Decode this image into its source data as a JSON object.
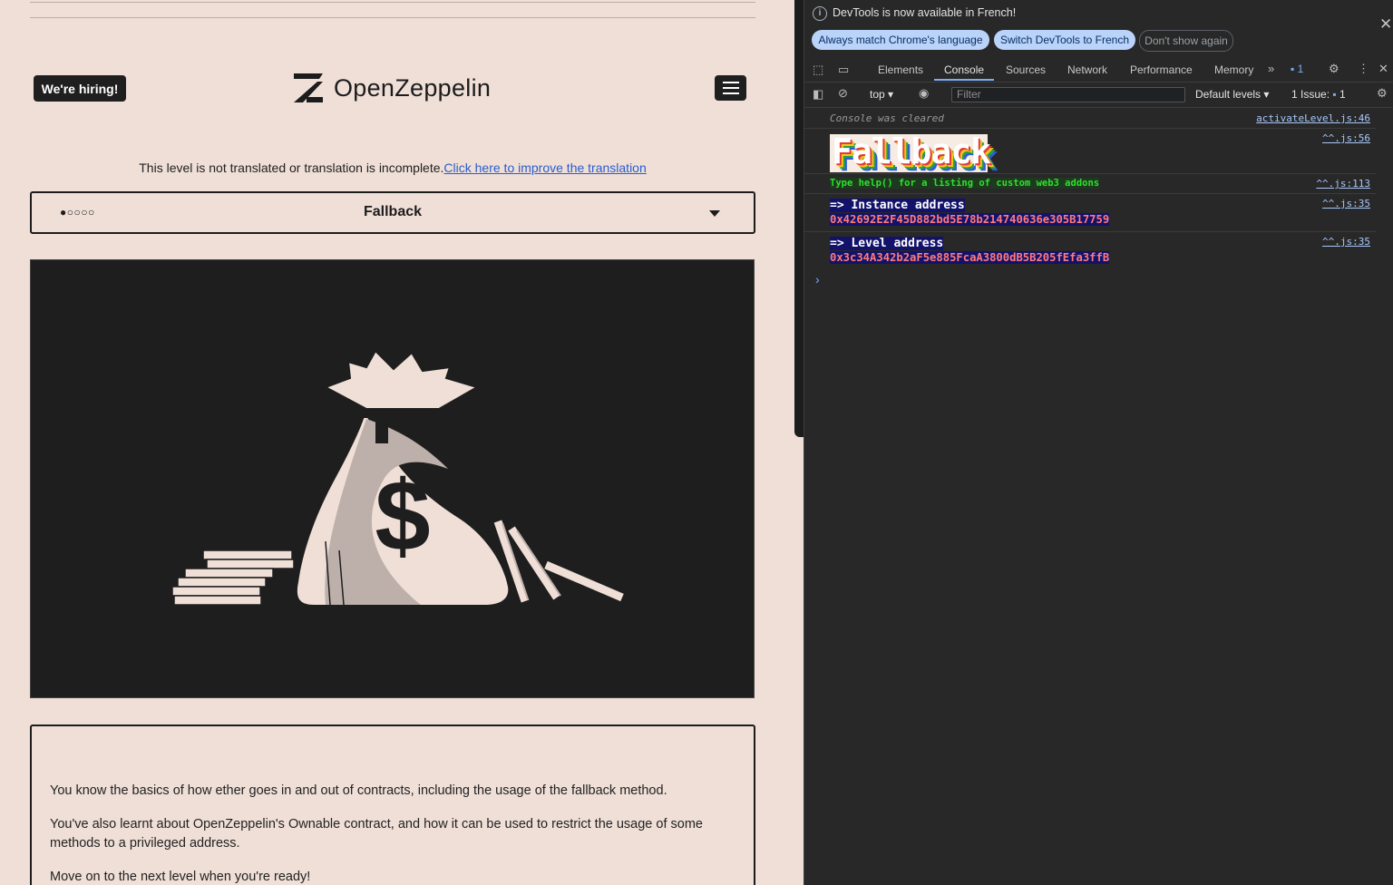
{
  "page": {
    "hiring_label": "We're hiring!",
    "logo_text": "OpenZeppelin",
    "notice_text": "This level is not translated or translation is incomplete.",
    "notice_link": "Click here to improve the translation",
    "level_dots": "●○○○○",
    "level_name": "Fallback",
    "description": [
      "You know the basics of how ether goes in and out of contracts, including the usage of the fallback method.",
      "You've also learnt about OpenZeppelin's Ownable contract, and how it can be used to restrict the usage of some methods to a privileged address.",
      "Move on to the next level when you're ready!"
    ]
  },
  "devtools": {
    "infobar": {
      "message": "DevTools is now available in French!",
      "btn_match": "Always match Chrome's language",
      "btn_switch": "Switch DevTools to French",
      "btn_dismiss": "Don't show again"
    },
    "tabs": [
      "Elements",
      "Console",
      "Sources",
      "Network",
      "Performance",
      "Memory"
    ],
    "active_tab": "Console",
    "messages_badge": "1",
    "toolbar": {
      "context": "top",
      "filter_placeholder": "Filter",
      "levels": "Default levels",
      "issues_label": "1 Issue:",
      "issues_count": "1"
    },
    "console": {
      "cleared": "Console was cleared",
      "cleared_src": "activateLevel.js:46",
      "banner": "Fallback",
      "banner_src": "^^.js:56",
      "help": "Type help() for a listing of custom web3 addons",
      "help_src": "^^.js:113",
      "instance_label": "=> Instance address",
      "instance_addr": "0x42692E2F45D882bd5E78b214740636e305B17759",
      "instance_src": "^^.js:35",
      "level_label": "=> Level address",
      "level_addr": "0x3c34A342b2aF5e885FcaA3800dB5B205fEfa3ffB",
      "level_src": "^^.js:35",
      "prompt": "›"
    },
    "colors": {
      "accent": "#7cacf8",
      "link": "#a8c7fa",
      "help_green": "#2de02d"
    }
  }
}
